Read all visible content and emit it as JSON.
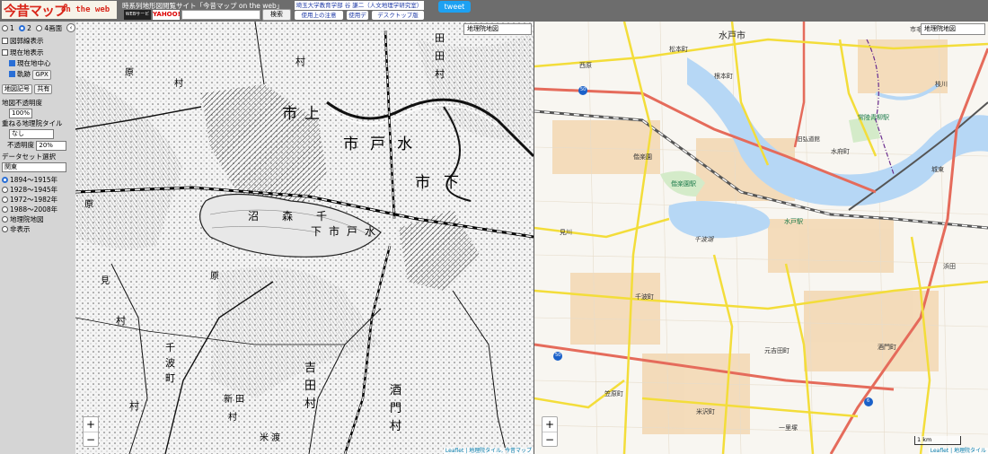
{
  "header": {
    "logo_main": "今昔マップ",
    "logo_sub": "on the web",
    "site_title": "時系列地形図閲覧サイト「今昔マップ on the web」",
    "search_service": "WEBサービス by",
    "yahoo": "YAHOO!",
    "search_button": "検索",
    "author": "埼玉大学教育学部 谷 謙二（人文地理学研究室）",
    "notice": "使用上の注意",
    "data": "使用データ",
    "desktop": "デスクトップ版",
    "tweet": "tweet"
  },
  "sidebar": {
    "view_options": [
      "1",
      "2",
      "4画面"
    ],
    "view_selected": 1,
    "figure_border": "図郭線表示",
    "current_location": "現在地表示",
    "current_center": "現在地中心",
    "track": "軌跡",
    "gpx": "GPX",
    "map_symbols": "地図記号",
    "share": "共有",
    "opacity_label": "地図不透明度",
    "opacity_value": "100%",
    "overlay_label": "重ねる地理院タイル",
    "overlay_value": "なし",
    "overlay_opacity_label": "不透明度",
    "overlay_opacity_value": "20%",
    "dataset_label": "データセット選択",
    "dataset_value": "関東",
    "periods": [
      "1894～1915年",
      "1928～1945年",
      "1972～1982年",
      "1988～2008年",
      "地理院地図",
      "非表示"
    ],
    "period_selected": 0
  },
  "left_map": {
    "layer": "地理院地図",
    "labels": [
      "市",
      "上",
      "市",
      "戸",
      "水",
      "下",
      "市",
      "沼",
      "森",
      "千",
      "下",
      "市",
      "戸",
      "水",
      "田",
      "田",
      "村",
      "村",
      "原",
      "村",
      "原",
      "見",
      "原",
      "千",
      "波",
      "町",
      "村",
      "吉",
      "田",
      "村",
      "村",
      "酒",
      "門",
      "村",
      "新",
      "田",
      "村",
      "米",
      "渡"
    ],
    "attribution": "Leaflet | 地理院タイル, 今昔マップ"
  },
  "right_map": {
    "layer": "地理院地図",
    "labels": [
      "水戸市",
      "市毛",
      "松本町",
      "根本町",
      "西原",
      "枝川",
      "常陸青柳駅",
      "水府町",
      "旧弘道館",
      "偕楽園",
      "偕楽園駅",
      "城東",
      "水戸駅",
      "千波湖",
      "見川",
      "浜田",
      "千波町",
      "元吉田町",
      "酒門町",
      "笠原町",
      "米沢町",
      "一里塚"
    ],
    "route_numbers": [
      "50",
      "50",
      "6"
    ],
    "scale": "1 km",
    "attribution": "Leaflet | 地理院タイル"
  },
  "colors": {
    "header_bg": "#6d6d6d",
    "sidebar_bg": "#d5d5d5",
    "logo_red": "#d9271b",
    "tweet_blue": "#1da1f2",
    "water_blue": "#b6d7f5",
    "road_yellow": "#f3dd3a",
    "road_red": "#e56b5b"
  }
}
